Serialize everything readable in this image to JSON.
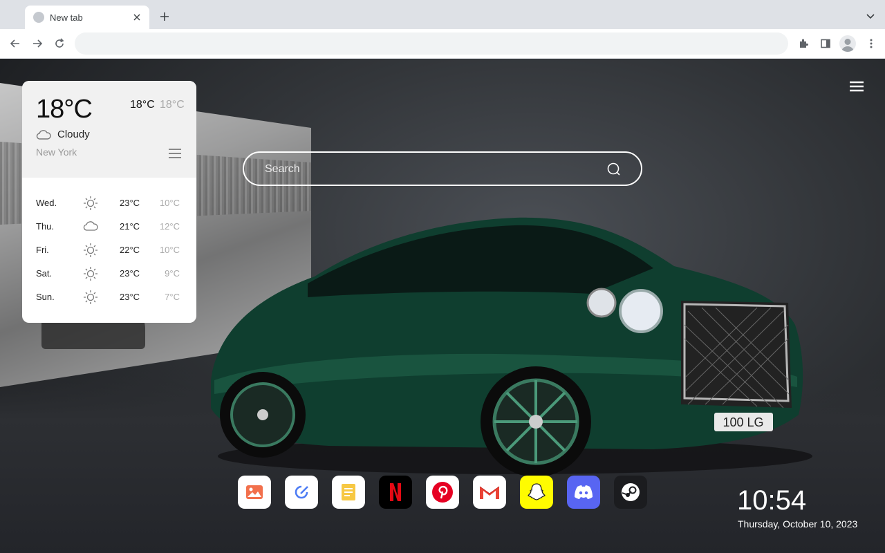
{
  "browser": {
    "tab_title": "New tab"
  },
  "weather": {
    "current_temp": "18°C",
    "high": "18°C",
    "low": "18°C",
    "condition": "Cloudy",
    "condition_icon": "cloud-icon",
    "city": "New York",
    "forecast": [
      {
        "day": "Wed.",
        "icon": "sun-icon",
        "high": "23°C",
        "low": "10°C"
      },
      {
        "day": "Thu.",
        "icon": "cloud-icon",
        "high": "21°C",
        "low": "12°C"
      },
      {
        "day": "Fri.",
        "icon": "sun-icon",
        "high": "22°C",
        "low": "10°C"
      },
      {
        "day": "Sat.",
        "icon": "sun-icon",
        "high": "23°C",
        "low": "9°C"
      },
      {
        "day": "Sun.",
        "icon": "sun-icon",
        "high": "23°C",
        "low": "7°C"
      }
    ]
  },
  "search": {
    "placeholder": "Search"
  },
  "dock": [
    {
      "name": "photos-app",
      "color": "#ffffff"
    },
    {
      "name": "edit-app",
      "color": "#ffffff"
    },
    {
      "name": "notes-app",
      "color": "#ffffff"
    },
    {
      "name": "netflix-app",
      "color": "#000000"
    },
    {
      "name": "pinterest-app",
      "color": "#ffffff"
    },
    {
      "name": "gmail-app",
      "color": "#ffffff"
    },
    {
      "name": "snapchat-app",
      "color": "#fffc00"
    },
    {
      "name": "discord-app",
      "color": "#5865f2"
    },
    {
      "name": "steam-app",
      "color": "#1b1c1f"
    }
  ],
  "clock": {
    "time": "10:54",
    "date": "Thursday, October 10, 2023"
  },
  "car": {
    "plate": "100 LG"
  }
}
